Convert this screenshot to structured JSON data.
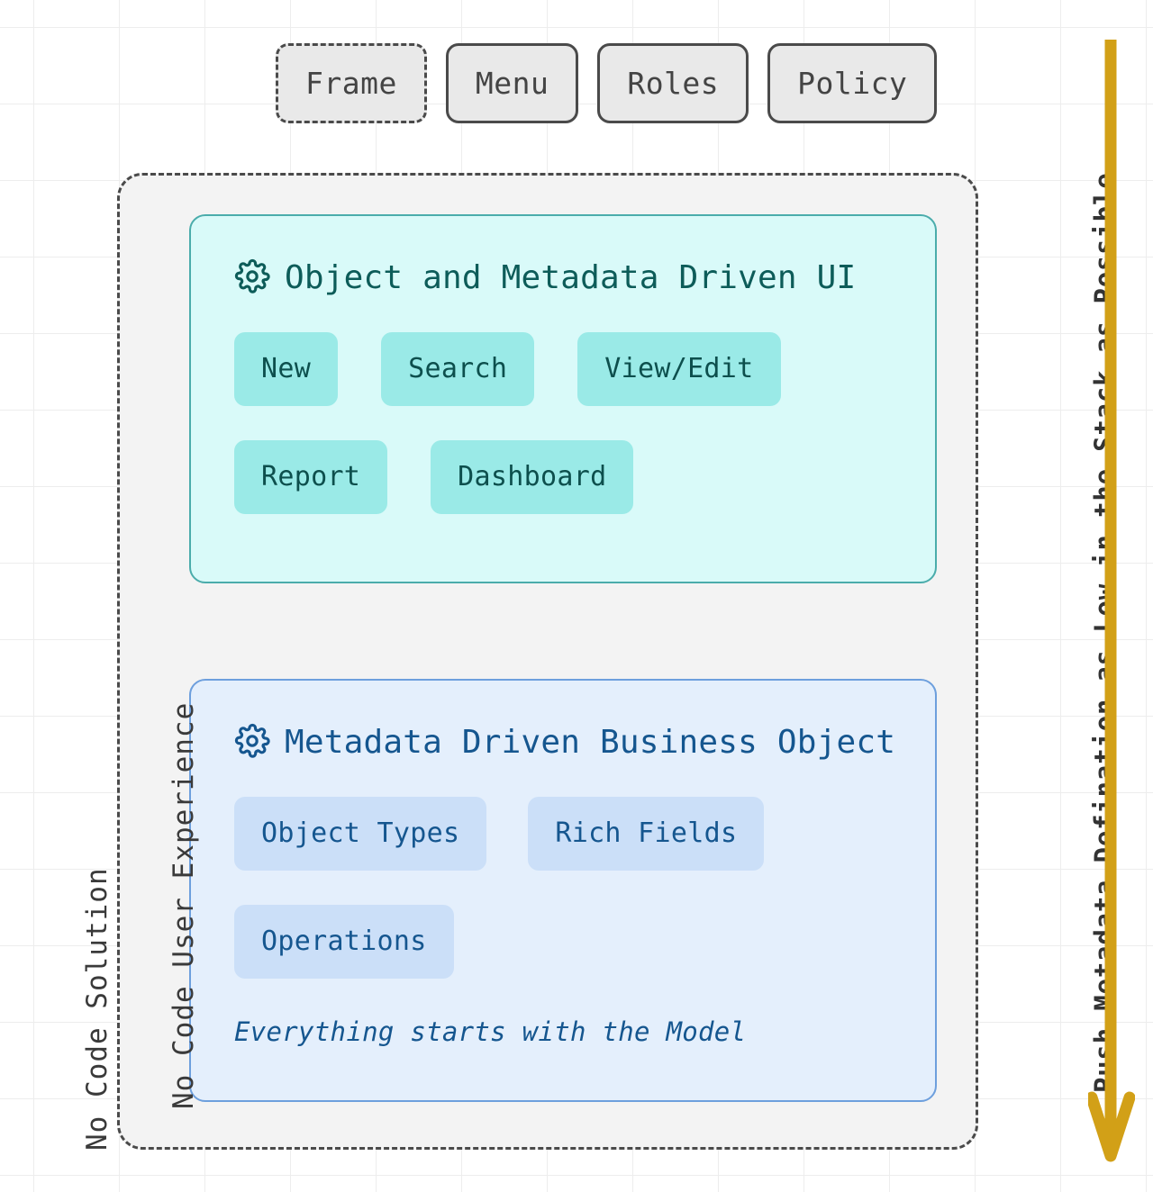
{
  "top_row": {
    "items": [
      {
        "label": "Frame",
        "style": "dashed"
      },
      {
        "label": "Menu",
        "style": "solid"
      },
      {
        "label": "Roles",
        "style": "solid"
      },
      {
        "label": "Policy",
        "style": "solid"
      }
    ]
  },
  "cards": {
    "ui": {
      "icon": "gear-icon",
      "title": "Object and Metadata Driven UI",
      "chips_row1": [
        "New",
        "Search",
        "View/Edit"
      ],
      "chips_row2": [
        "Report",
        "Dashboard"
      ]
    },
    "object": {
      "icon": "gear-icon",
      "title": "Metadata Driven Business Object",
      "chips_row1": [
        "Object Types",
        "Rich Fields"
      ],
      "chips_row2": [
        "Operations"
      ],
      "note": "Everything starts with the Model"
    }
  },
  "side_labels": {
    "outer_left": "No Code Solution",
    "inner_left": "No Code User Experience",
    "right": "Push Metadata Defination as Low in the Stack as Possible"
  },
  "arrow": {
    "name": "downward-arrow",
    "direction": "down"
  },
  "colors": {
    "ui_card_bg": "#d9faf9",
    "ui_card_border": "#4aacab",
    "ui_chip_bg": "#9aeae7",
    "ui_text": "#0d5c59",
    "object_card_bg": "#e4effc",
    "object_card_border": "#6d9fdd",
    "object_chip_bg": "#cbdff8",
    "object_text": "#15568f",
    "outer_box_bg": "#f3f3f3",
    "outer_box_border": "#4a4a4a",
    "top_pill_bg": "#e9e9e9",
    "arrow": "#d2a017",
    "grid_line": "#ededed"
  }
}
